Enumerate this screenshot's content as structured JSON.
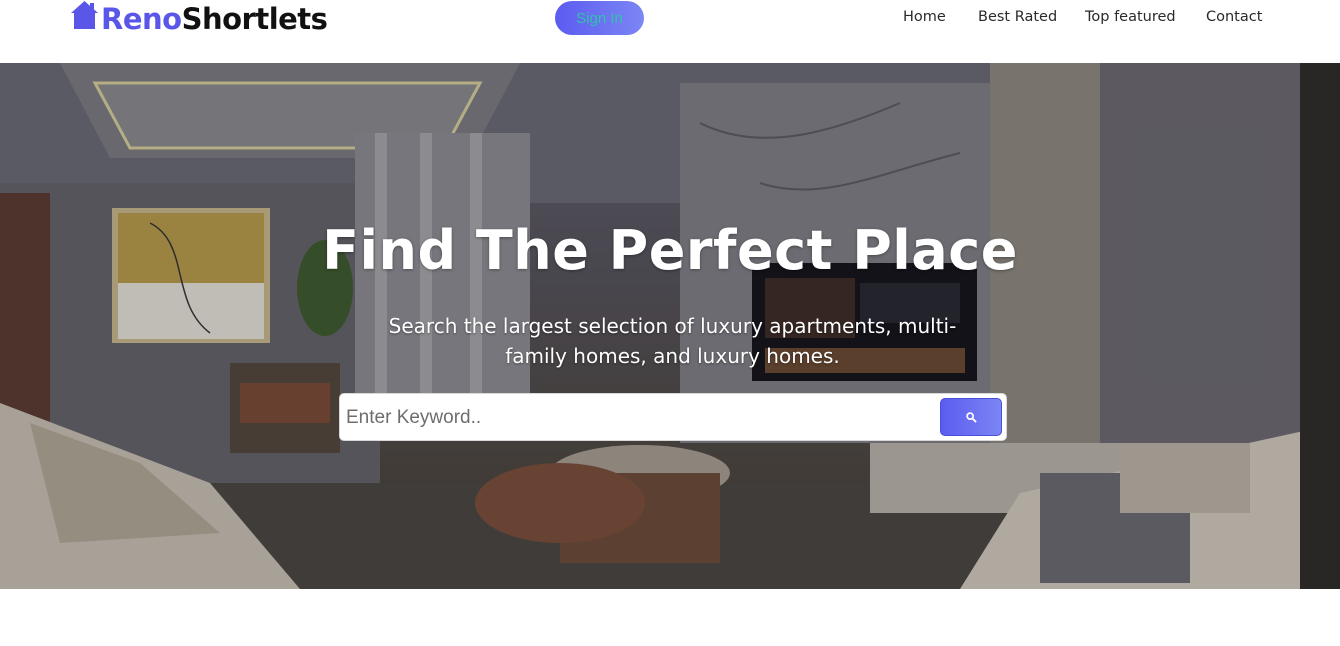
{
  "header": {
    "logo": {
      "part1": "Reno",
      "part2": "Shortlets",
      "icon": "house-icon"
    },
    "signin_label": "Sign In",
    "nav": [
      {
        "label": "Home"
      },
      {
        "label": "Best Rated"
      },
      {
        "label": "Top featured"
      },
      {
        "label": "Contact"
      }
    ]
  },
  "hero": {
    "title": "Find The Perfect Place",
    "subtitle": "Search the largest selection of luxury apartments, multi-family homes, and luxury homes.",
    "search": {
      "placeholder": "Enter Keyword..",
      "value": "",
      "button_icon": "search-icon"
    }
  },
  "colors": {
    "brand": "#5a57e8",
    "button_gradient_start": "#5b5cf0",
    "button_gradient_end": "#7c86f4",
    "signin_text": "#2ec4a8"
  }
}
